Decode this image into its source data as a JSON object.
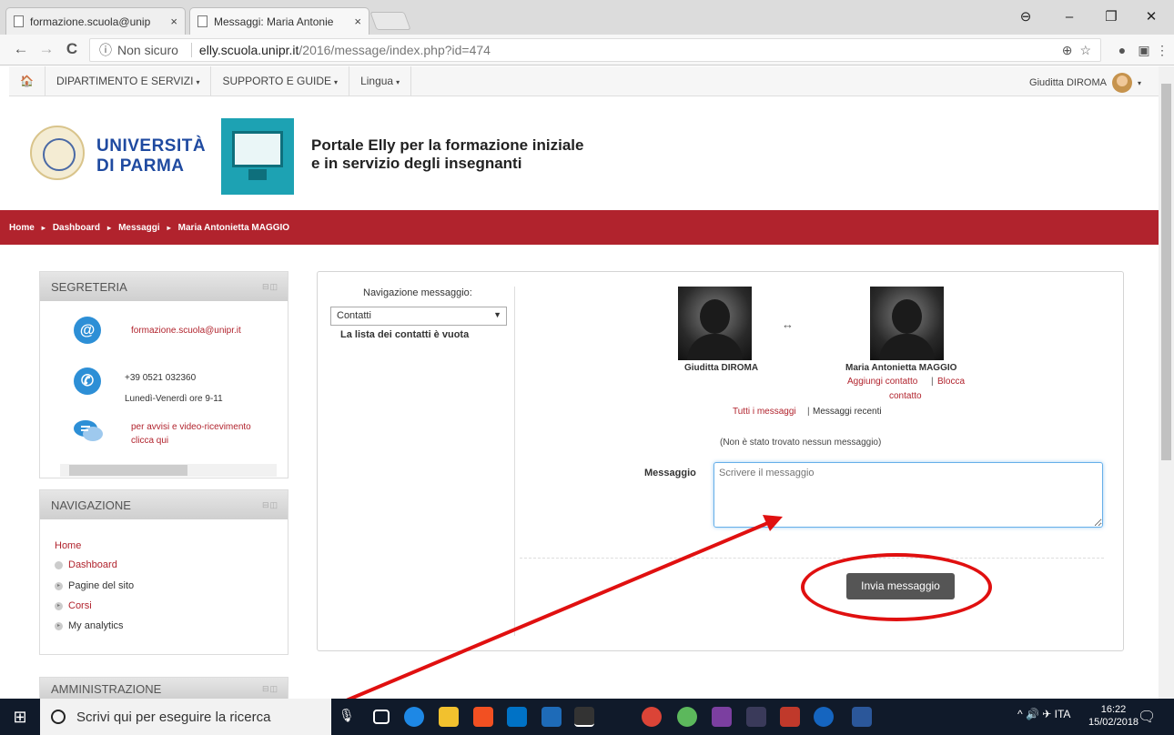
{
  "browser": {
    "tabs": [
      {
        "title": "formazione.scuola@unip"
      },
      {
        "title": "Messaggi: Maria Antonie"
      }
    ],
    "tab_close": "×",
    "security_label": "Non sicuro",
    "url_host": "elly.scuola.unipr.it",
    "url_path": "/2016/message/index.php?id=474",
    "controls": {
      "back": "←",
      "forward": "→",
      "reload": "C",
      "minimize": "–",
      "maximize": "❐",
      "close": "✕",
      "account": "⊖",
      "zoom": "⊕",
      "star": "☆",
      "menu": "⋮"
    }
  },
  "site_nav": {
    "home_icon": "🏠",
    "items": [
      {
        "label": "DIPARTIMENTO E SERVIZI"
      },
      {
        "label": "SUPPORTO E GUIDE"
      },
      {
        "label": "Lingua"
      }
    ],
    "caret": "▾",
    "user_name": "Giuditta DIROMA"
  },
  "header": {
    "university": "UNIVERSITÀ\nDI PARMA",
    "portal_title": "Portale Elly per la formazione iniziale\ne in servizio degli insegnanti"
  },
  "breadcrumb": {
    "items": [
      "Home",
      "Dashboard",
      "Messaggi",
      "Maria Antonietta MAGGIO"
    ],
    "separator": "▸"
  },
  "blocks": {
    "segreteria": {
      "title": "SEGRETERIA",
      "email": "formazione.scuola@unipr.it",
      "phone": "+39 0521 032360",
      "hours": "Lunedì-Venerdì ore 9-11",
      "notice": "per avvisi e video-ricevimento\nclicca qui"
    },
    "navigazione": {
      "title": "NAVIGAZIONE",
      "home": "Home",
      "items": [
        "Dashboard",
        "Pagine del sito",
        "Corsi",
        "My analytics"
      ]
    },
    "amministrazione": {
      "title": "AMMINISTRAZIONE"
    },
    "controls": "⊟◫"
  },
  "messages": {
    "nav_label": "Navigazione messaggio:",
    "select_value": "Contatti",
    "empty_contacts": "La lista dei contatti è vuota",
    "user_a": "Giuditta DIROMA",
    "user_b": "Maria Antonietta MAGGIO",
    "swap_symbol": "↔",
    "add_contact": "Aggiungi contatto",
    "block_contact_1": "Blocca",
    "block_contact_2": "contatto",
    "link_sep": "|",
    "all_messages": "Tutti i messaggi",
    "recent_messages": "Messaggi recenti",
    "no_messages": "(Non è stato trovato nessun messaggio)",
    "message_label": "Messaggio",
    "message_placeholder": "Scrivere il messaggio",
    "send_button": "Invia messaggio"
  },
  "taskbar": {
    "search_placeholder": "Scrivi qui per eseguire la ricerca",
    "language": "ITA",
    "time": "16:22",
    "date": "15/02/2018"
  },
  "colors": {
    "accent": "#b1232d",
    "annotation": "#e01010"
  }
}
